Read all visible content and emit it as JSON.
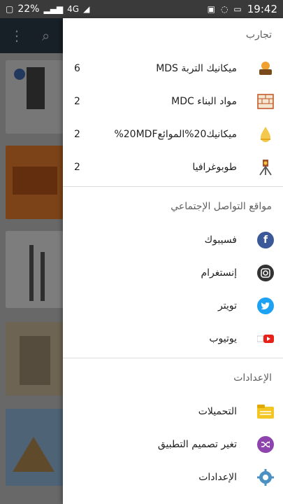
{
  "status": {
    "battery": "22%",
    "network": "4G",
    "time": "19:42"
  },
  "drawer": {
    "sections": [
      {
        "title": "تجارب",
        "items": [
          {
            "label": "ميكانيك التربة MDS",
            "count": "6",
            "icon": "soil-mechanics-icon"
          },
          {
            "label": "مواد البناء MDC",
            "count": "2",
            "icon": "building-materials-icon"
          },
          {
            "label": "ميكانيك20%الموائع20MDF%",
            "count": "2",
            "icon": "fluid-mechanics-icon"
          },
          {
            "label": "طوبوغرافيا",
            "count": "2",
            "icon": "topography-icon"
          }
        ]
      },
      {
        "title": "مواقع التواصل الإجتماعي",
        "items": [
          {
            "label": "فسيبوك",
            "icon": "facebook-icon"
          },
          {
            "label": "إنستغرام",
            "icon": "instagram-icon"
          },
          {
            "label": "تويتر",
            "icon": "twitter-icon"
          },
          {
            "label": "يوتيوب",
            "icon": "youtube-icon"
          }
        ]
      },
      {
        "title": "الإعدادات",
        "items": [
          {
            "label": "التحميلات",
            "icon": "downloads-icon"
          },
          {
            "label": "تغير تصميم التطبيق",
            "icon": "shuffle-icon"
          },
          {
            "label": "الإعدادات",
            "icon": "settings-icon"
          }
        ]
      }
    ]
  },
  "colors": {
    "facebook": "#3b5998",
    "instagram": "#333333",
    "twitter": "#1da1f2",
    "youtube": "#e62117",
    "shuffle": "#8e44ad",
    "settings": "#4a90c2",
    "downloads": "#f3c623"
  }
}
